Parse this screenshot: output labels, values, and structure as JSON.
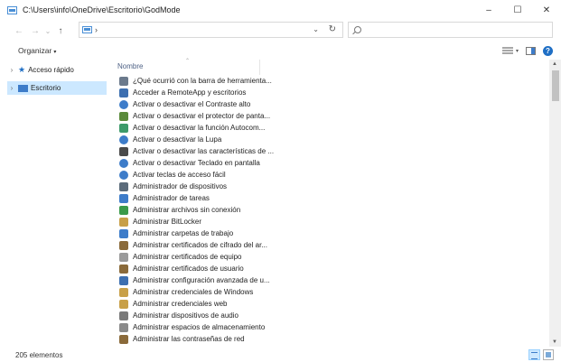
{
  "window": {
    "title": "C:\\Users\\info\\OneDrive\\Escritorio\\GodMode",
    "minimize_glyph": "–",
    "maximize_glyph": "☐",
    "close_glyph": "✕"
  },
  "navigation": {
    "back_glyph": "←",
    "forward_glyph": "→",
    "recent_glyph": "⌄",
    "up_glyph": "↑",
    "address_separator": "›",
    "address_dropdown_glyph": "⌄",
    "refresh_glyph": "↻"
  },
  "toolbar": {
    "organize_label": "Organizar",
    "caret": "▾"
  },
  "sidebar": {
    "items": [
      {
        "label": "Acceso rápido",
        "icon": "star-icon",
        "expander": "›",
        "selected": false
      },
      {
        "label": "Escritorio",
        "icon": "desktop-icon",
        "expander": "›",
        "selected": true
      }
    ]
  },
  "content": {
    "column_header": "Nombre",
    "sort_glyph": "⌃",
    "files": [
      {
        "name": "¿Qué ocurrió con la barra de herramienta...",
        "icon": "taskbar-icon",
        "color": "#6b7a8c"
      },
      {
        "name": "Acceder a RemoteApp y escritorios",
        "icon": "remoteapp-icon",
        "color": "#3d6fb0"
      },
      {
        "name": "Activar o desactivar el Contraste alto",
        "icon": "ease-of-access-icon",
        "color": "#3d7cc9"
      },
      {
        "name": "Activar o desactivar el protector de panta...",
        "icon": "screensaver-icon",
        "color": "#5a8a3a"
      },
      {
        "name": "Activar o desactivar la función Autocom...",
        "icon": "autoplay-icon",
        "color": "#3d9a6a"
      },
      {
        "name": "Activar o desactivar la Lupa",
        "icon": "ease-of-access-icon",
        "color": "#3d7cc9"
      },
      {
        "name": "Activar o desactivar las características de ...",
        "icon": "features-icon",
        "color": "#4a4a4a"
      },
      {
        "name": "Activar o desactivar Teclado en pantalla",
        "icon": "ease-of-access-icon",
        "color": "#3d7cc9"
      },
      {
        "name": "Activar teclas de acceso fácil",
        "icon": "ease-of-access-icon",
        "color": "#3d7cc9"
      },
      {
        "name": "Administrador de dispositivos",
        "icon": "device-manager-icon",
        "color": "#5b6b7b"
      },
      {
        "name": "Administrador de tareas",
        "icon": "task-manager-icon",
        "color": "#3d7cc9"
      },
      {
        "name": "Administrar archivos sin conexión",
        "icon": "sync-icon",
        "color": "#3a9a4a"
      },
      {
        "name": "Administrar BitLocker",
        "icon": "bitlocker-icon",
        "color": "#c8a048"
      },
      {
        "name": "Administrar carpetas de trabajo",
        "icon": "work-folders-icon",
        "color": "#3d7cc9"
      },
      {
        "name": "Administrar certificados de cifrado del ar...",
        "icon": "certificate-icon",
        "color": "#8a6a3a"
      },
      {
        "name": "Administrar certificados de equipo",
        "icon": "certificate-icon",
        "color": "#9a9a9a"
      },
      {
        "name": "Administrar certificados de usuario",
        "icon": "certificate-icon",
        "color": "#8a6a3a"
      },
      {
        "name": "Administrar configuración avanzada de u...",
        "icon": "network-icon",
        "color": "#3d6fb0"
      },
      {
        "name": "Administrar credenciales de Windows",
        "icon": "credentials-icon",
        "color": "#c8a048"
      },
      {
        "name": "Administrar credenciales web",
        "icon": "credentials-icon",
        "color": "#c8a048"
      },
      {
        "name": "Administrar dispositivos de audio",
        "icon": "audio-icon",
        "color": "#7a7a7a"
      },
      {
        "name": "Administrar espacios de almacenamiento",
        "icon": "storage-icon",
        "color": "#8a8a8a"
      },
      {
        "name": "Administrar las contraseñas de red",
        "icon": "network-passwords-icon",
        "color": "#8a6a3a"
      }
    ]
  },
  "status": {
    "item_count": "205 elementos"
  }
}
